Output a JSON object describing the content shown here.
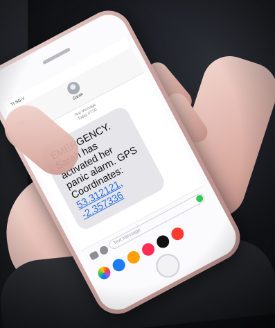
{
  "status": {
    "carrier": "TI-SG-Y",
    "right": ""
  },
  "thread": {
    "contact": "Sarah",
    "meta_line1": "Text Message",
    "meta_line2": "Today 07:00"
  },
  "message": {
    "text": "EMERGENCY. Sarah has activated her panic alarm. GPS Coordinates:",
    "link_line1": "53.312121,",
    "link_line2": "-2.357336"
  },
  "composer": {
    "placeholder": "Text Message"
  },
  "icons": [
    "back-chevron-icon",
    "camera-icon",
    "appstore-icon",
    "send-icon",
    "home-button-icon"
  ]
}
